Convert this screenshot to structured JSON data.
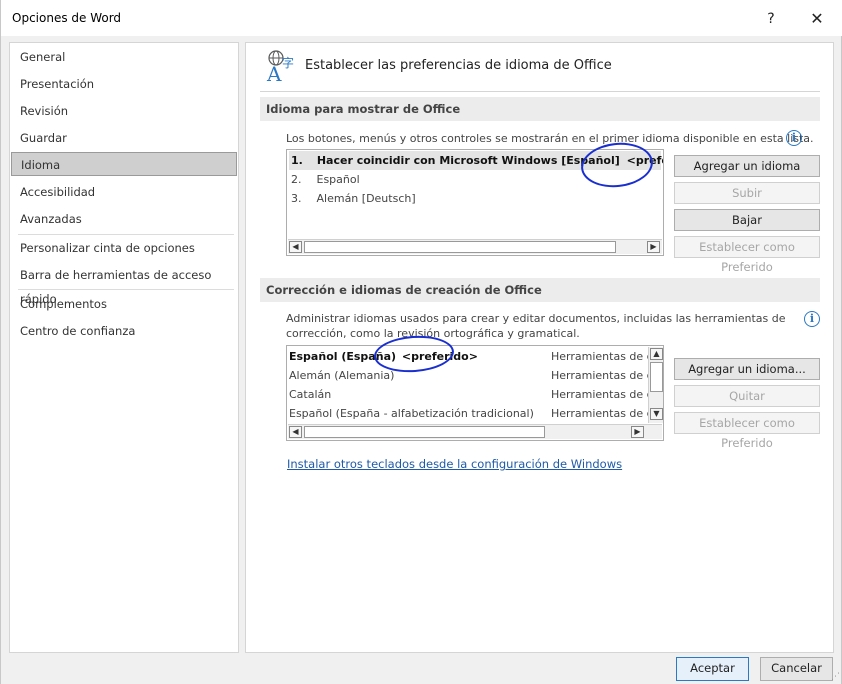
{
  "window": {
    "title": "Opciones de Word",
    "help_glyph": "?",
    "close_glyph": "✕"
  },
  "sidebar": {
    "items": [
      {
        "label": "General"
      },
      {
        "label": "Presentación"
      },
      {
        "label": "Revisión"
      },
      {
        "label": "Guardar"
      },
      {
        "label": "Idioma",
        "selected": true
      },
      {
        "label": "Accesibilidad"
      },
      {
        "label": "Avanzadas"
      },
      {
        "label": "Personalizar cinta de opciones"
      },
      {
        "label": "Barra de herramientas de acceso rápido"
      },
      {
        "label": "Complementos"
      },
      {
        "label": "Centro de confianza"
      }
    ]
  },
  "header": {
    "icon": "language-icon",
    "text": "Establecer las preferencias de idioma de Office"
  },
  "display_section": {
    "title": "Idioma para mostrar de Office",
    "description": "Los botones, menús y otros controles se mostrarán en el primer idioma disponible en esta lista.",
    "info_glyph": "i",
    "list": [
      {
        "num": "1.",
        "label": "Hacer coincidir con Microsoft Windows [Español]",
        "tag": "<preferido>",
        "selected": true
      },
      {
        "num": "2.",
        "label": "Español"
      },
      {
        "num": "3.",
        "label": "Alemán [Deutsch]"
      }
    ],
    "buttons": {
      "add": "Agregar un idioma",
      "up": "Subir",
      "down": "Bajar",
      "set_preferred": "Establecer como Preferido"
    }
  },
  "authoring_section": {
    "title": "Corrección e idiomas de creación de Office",
    "description_line1": "Administrar idiomas usados para crear y editar documentos, incluidas las herramientas de",
    "description_line2": "corrección, como la revisión ortográfica y gramatical.",
    "info_glyph": "i",
    "list": [
      {
        "label": "Español (España)",
        "tag": "<preferido>",
        "tools": "Herramientas de c",
        "bold": true
      },
      {
        "label": "Alemán (Alemania)",
        "tools": "Herramientas de c"
      },
      {
        "label": "Catalán",
        "tools": "Herramientas de c"
      },
      {
        "label": "Español (España - alfabetización tradicional)",
        "tools": "Herramientas de c"
      }
    ],
    "buttons": {
      "add": "Agregar un idioma...",
      "remove": "Quitar",
      "set_preferred": "Establecer como Preferido"
    }
  },
  "link_text": "Instalar otros teclados desde la configuración de Windows",
  "footer": {
    "ok": "Aceptar",
    "cancel": "Cancelar"
  },
  "colors": {
    "accent": "#2b78c5",
    "annotation": "#1a2fd0",
    "link": "#1f5aa8"
  }
}
